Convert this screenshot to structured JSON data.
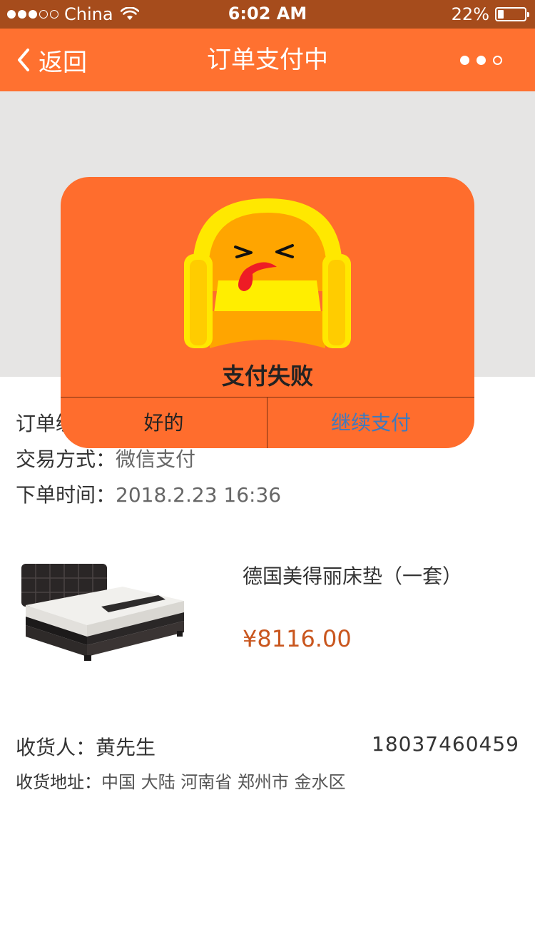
{
  "status_bar": {
    "carrier": "China",
    "time": "6:02 AM",
    "battery_percent": "22%",
    "battery_level": 0.22,
    "signal_bars": 3,
    "signal_total": 5
  },
  "nav": {
    "back_label": "返回",
    "title": "订单支付中",
    "more_icon": "more-dots-icon"
  },
  "order": {
    "number_label": "订单编号：",
    "pay_method_label": "交易方式：",
    "pay_method_value": "微信支付",
    "time_label": "下单时间：",
    "time_value": "2018.2.23 16:36"
  },
  "product": {
    "name": "德国美得丽床垫（一套）",
    "price": "¥8116.00",
    "image_icon": "bed-product-image"
  },
  "consignee": {
    "receiver_label": "收货人：",
    "receiver_name": "黄先生",
    "phone": "18037460459",
    "address_label": "收货地址：",
    "address_value": "中国 大陆 河南省 郑州市 金水区"
  },
  "dialog": {
    "title": "支付失败",
    "ok_label": "好的",
    "continue_label": "继续支付",
    "illustration": "sad-sofa-illustration"
  },
  "colors": {
    "status_bar": "#a64c1c",
    "nav_bar": "#ff7130",
    "dialog_bg": "#ff6d2d",
    "price": "#c9561e",
    "continue_link": "#3e7abf"
  }
}
